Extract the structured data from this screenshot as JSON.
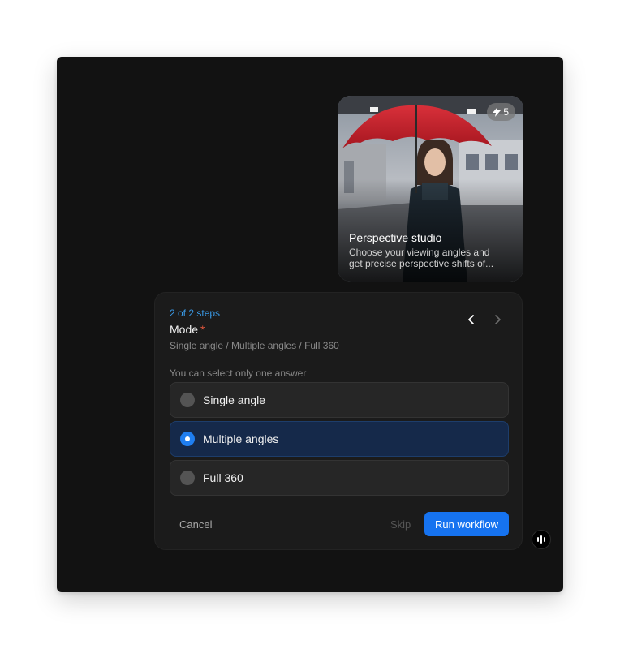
{
  "card": {
    "badge_count": "5",
    "badge_icon": "bolt-icon",
    "title": "Perspective studio",
    "description_line1": "Choose your viewing angles and",
    "description_line2": "get precise perspective shifts of..."
  },
  "panel": {
    "steps": "2 of 2 steps",
    "question": "Mode",
    "required_mark": "*",
    "subtitle": "Single angle / Multiple angles / Full 360",
    "hint": "You can select only one answer",
    "options": [
      {
        "label": "Single angle",
        "selected": false
      },
      {
        "label": "Multiple angles",
        "selected": true
      },
      {
        "label": "Full 360",
        "selected": false
      }
    ],
    "cancel_label": "Cancel",
    "skip_label": "Skip",
    "run_label": "Run workflow"
  },
  "colors": {
    "accent": "#1673f0",
    "steps_text": "#3a9be8",
    "required": "#e0563c",
    "selected_bg": "#15294a",
    "window_bg": "#121212"
  }
}
